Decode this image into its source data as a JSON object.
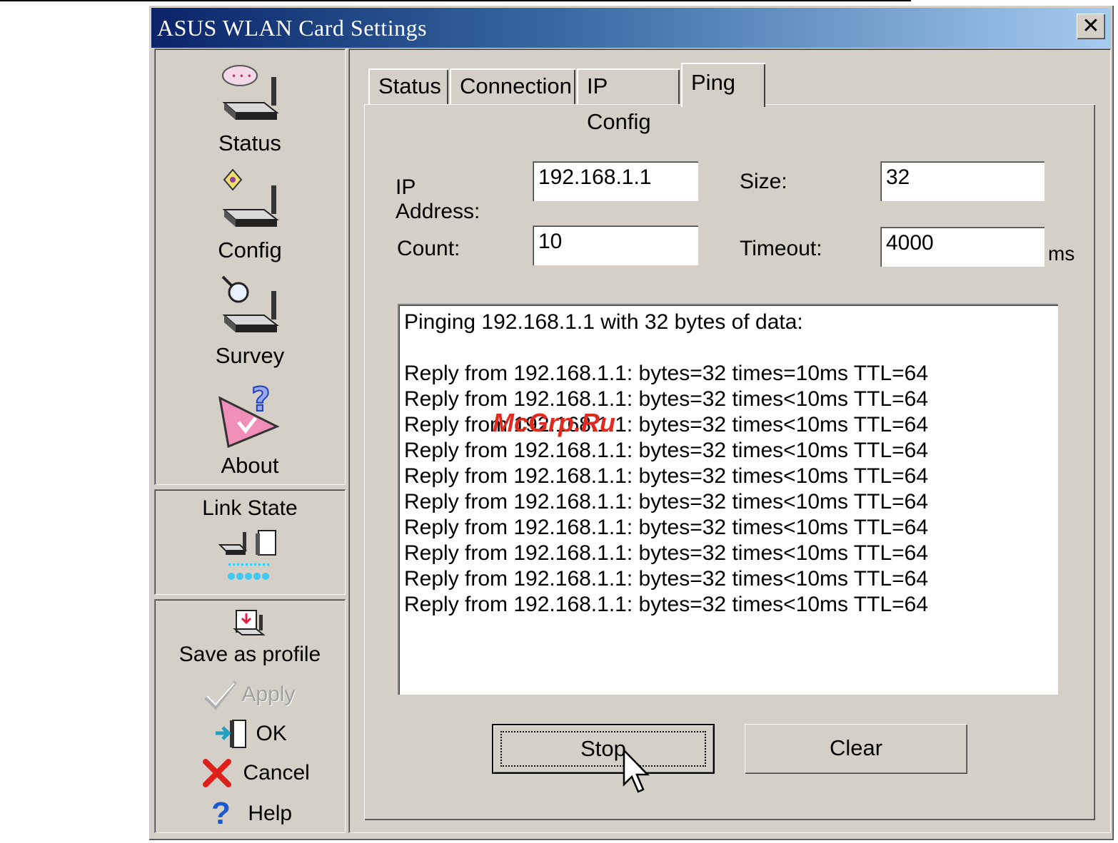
{
  "window": {
    "title": "ASUS WLAN Card Settings",
    "close_glyph": "✕"
  },
  "sidebar": {
    "nav": [
      {
        "label": "Status",
        "icon": "router-chat-icon"
      },
      {
        "label": "Config",
        "icon": "router-config-icon"
      },
      {
        "label": "Survey",
        "icon": "router-search-icon"
      },
      {
        "label": "About",
        "icon": "about-question-icon"
      }
    ],
    "link_state": {
      "label": "Link State"
    },
    "actions": [
      {
        "label": "Save as profile",
        "icon": "save-profile-icon",
        "enabled": true
      },
      {
        "label": "Apply",
        "icon": "checkmark-icon",
        "enabled": false
      },
      {
        "label": "OK",
        "icon": "ok-door-icon",
        "enabled": true
      },
      {
        "label": "Cancel",
        "icon": "red-x-icon",
        "enabled": true
      },
      {
        "label": "Help",
        "icon": "question-icon",
        "enabled": true
      }
    ]
  },
  "tabs": [
    "Status",
    "Connection",
    "IP Config",
    "Ping"
  ],
  "active_tab": "Ping",
  "ping": {
    "ip_label": "IP Address:",
    "ip_value": "192.168.1.1",
    "size_label": "Size:",
    "size_value": "32",
    "count_label": "Count:",
    "count_value": "10",
    "timeout_label": "Timeout:",
    "timeout_value": "4000",
    "timeout_unit": "ms",
    "output": [
      "Pinging 192.168.1.1 with 32 bytes of data:",
      "",
      "Reply from 192.168.1.1: bytes=32 times=10ms TTL=64",
      "Reply from 192.168.1.1: bytes=32 times<10ms TTL=64",
      "Reply from 192.168.1.1: bytes=32 times<10ms TTL=64",
      "Reply from 192.168.1.1: bytes=32 times<10ms TTL=64",
      "Reply from 192.168.1.1: bytes=32 times<10ms TTL=64",
      "Reply from 192.168.1.1: bytes=32 times<10ms TTL=64",
      "Reply from 192.168.1.1: bytes=32 times<10ms TTL=64",
      "Reply from 192.168.1.1: bytes=32 times<10ms TTL=64",
      "Reply from 192.168.1.1: bytes=32 times<10ms TTL=64",
      "Reply from 192.168.1.1: bytes=32 times<10ms TTL=64"
    ],
    "stop_label": "Stop",
    "clear_label": "Clear"
  },
  "watermark": "McGrp.Ru",
  "colors": {
    "dialog_bg": "#d4d0c8",
    "title_start": "#0a246a",
    "title_end": "#a6caf0",
    "cancel_red": "#e0201a",
    "help_blue": "#1a5ad0"
  }
}
